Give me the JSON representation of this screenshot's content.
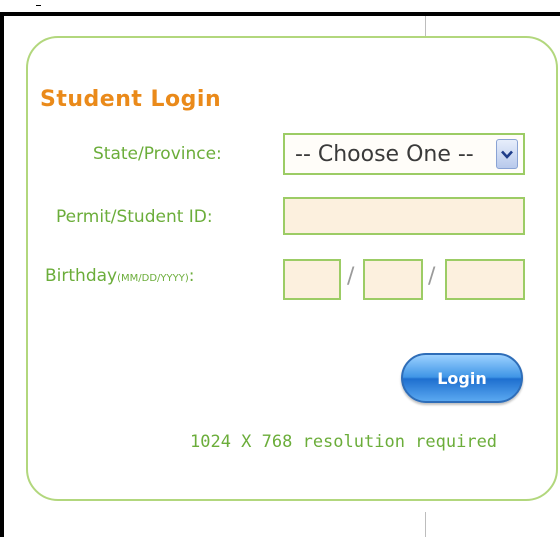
{
  "login": {
    "title": "Student Login",
    "state_label": "State/Province:",
    "state_selected": "-- Choose One --",
    "permit_label": "Permit/Student ID:",
    "permit_value": "",
    "birthday_label": "Birthday",
    "birthday_format": "(MM/DD/YYYY)",
    "birthday_colon": ":",
    "birthday_month": "",
    "birthday_day": "",
    "birthday_year": "",
    "separator": "/",
    "button_label": "Login",
    "resolution_note": "1024 X 768 resolution required"
  },
  "colors": {
    "title": "#ea8a1a",
    "label": "#6bad3a",
    "border": "#9ccc65",
    "field_background": "#fcf0de",
    "button": "#3f95e6"
  },
  "icons": {
    "select_arrow": "chevron-down-icon"
  }
}
